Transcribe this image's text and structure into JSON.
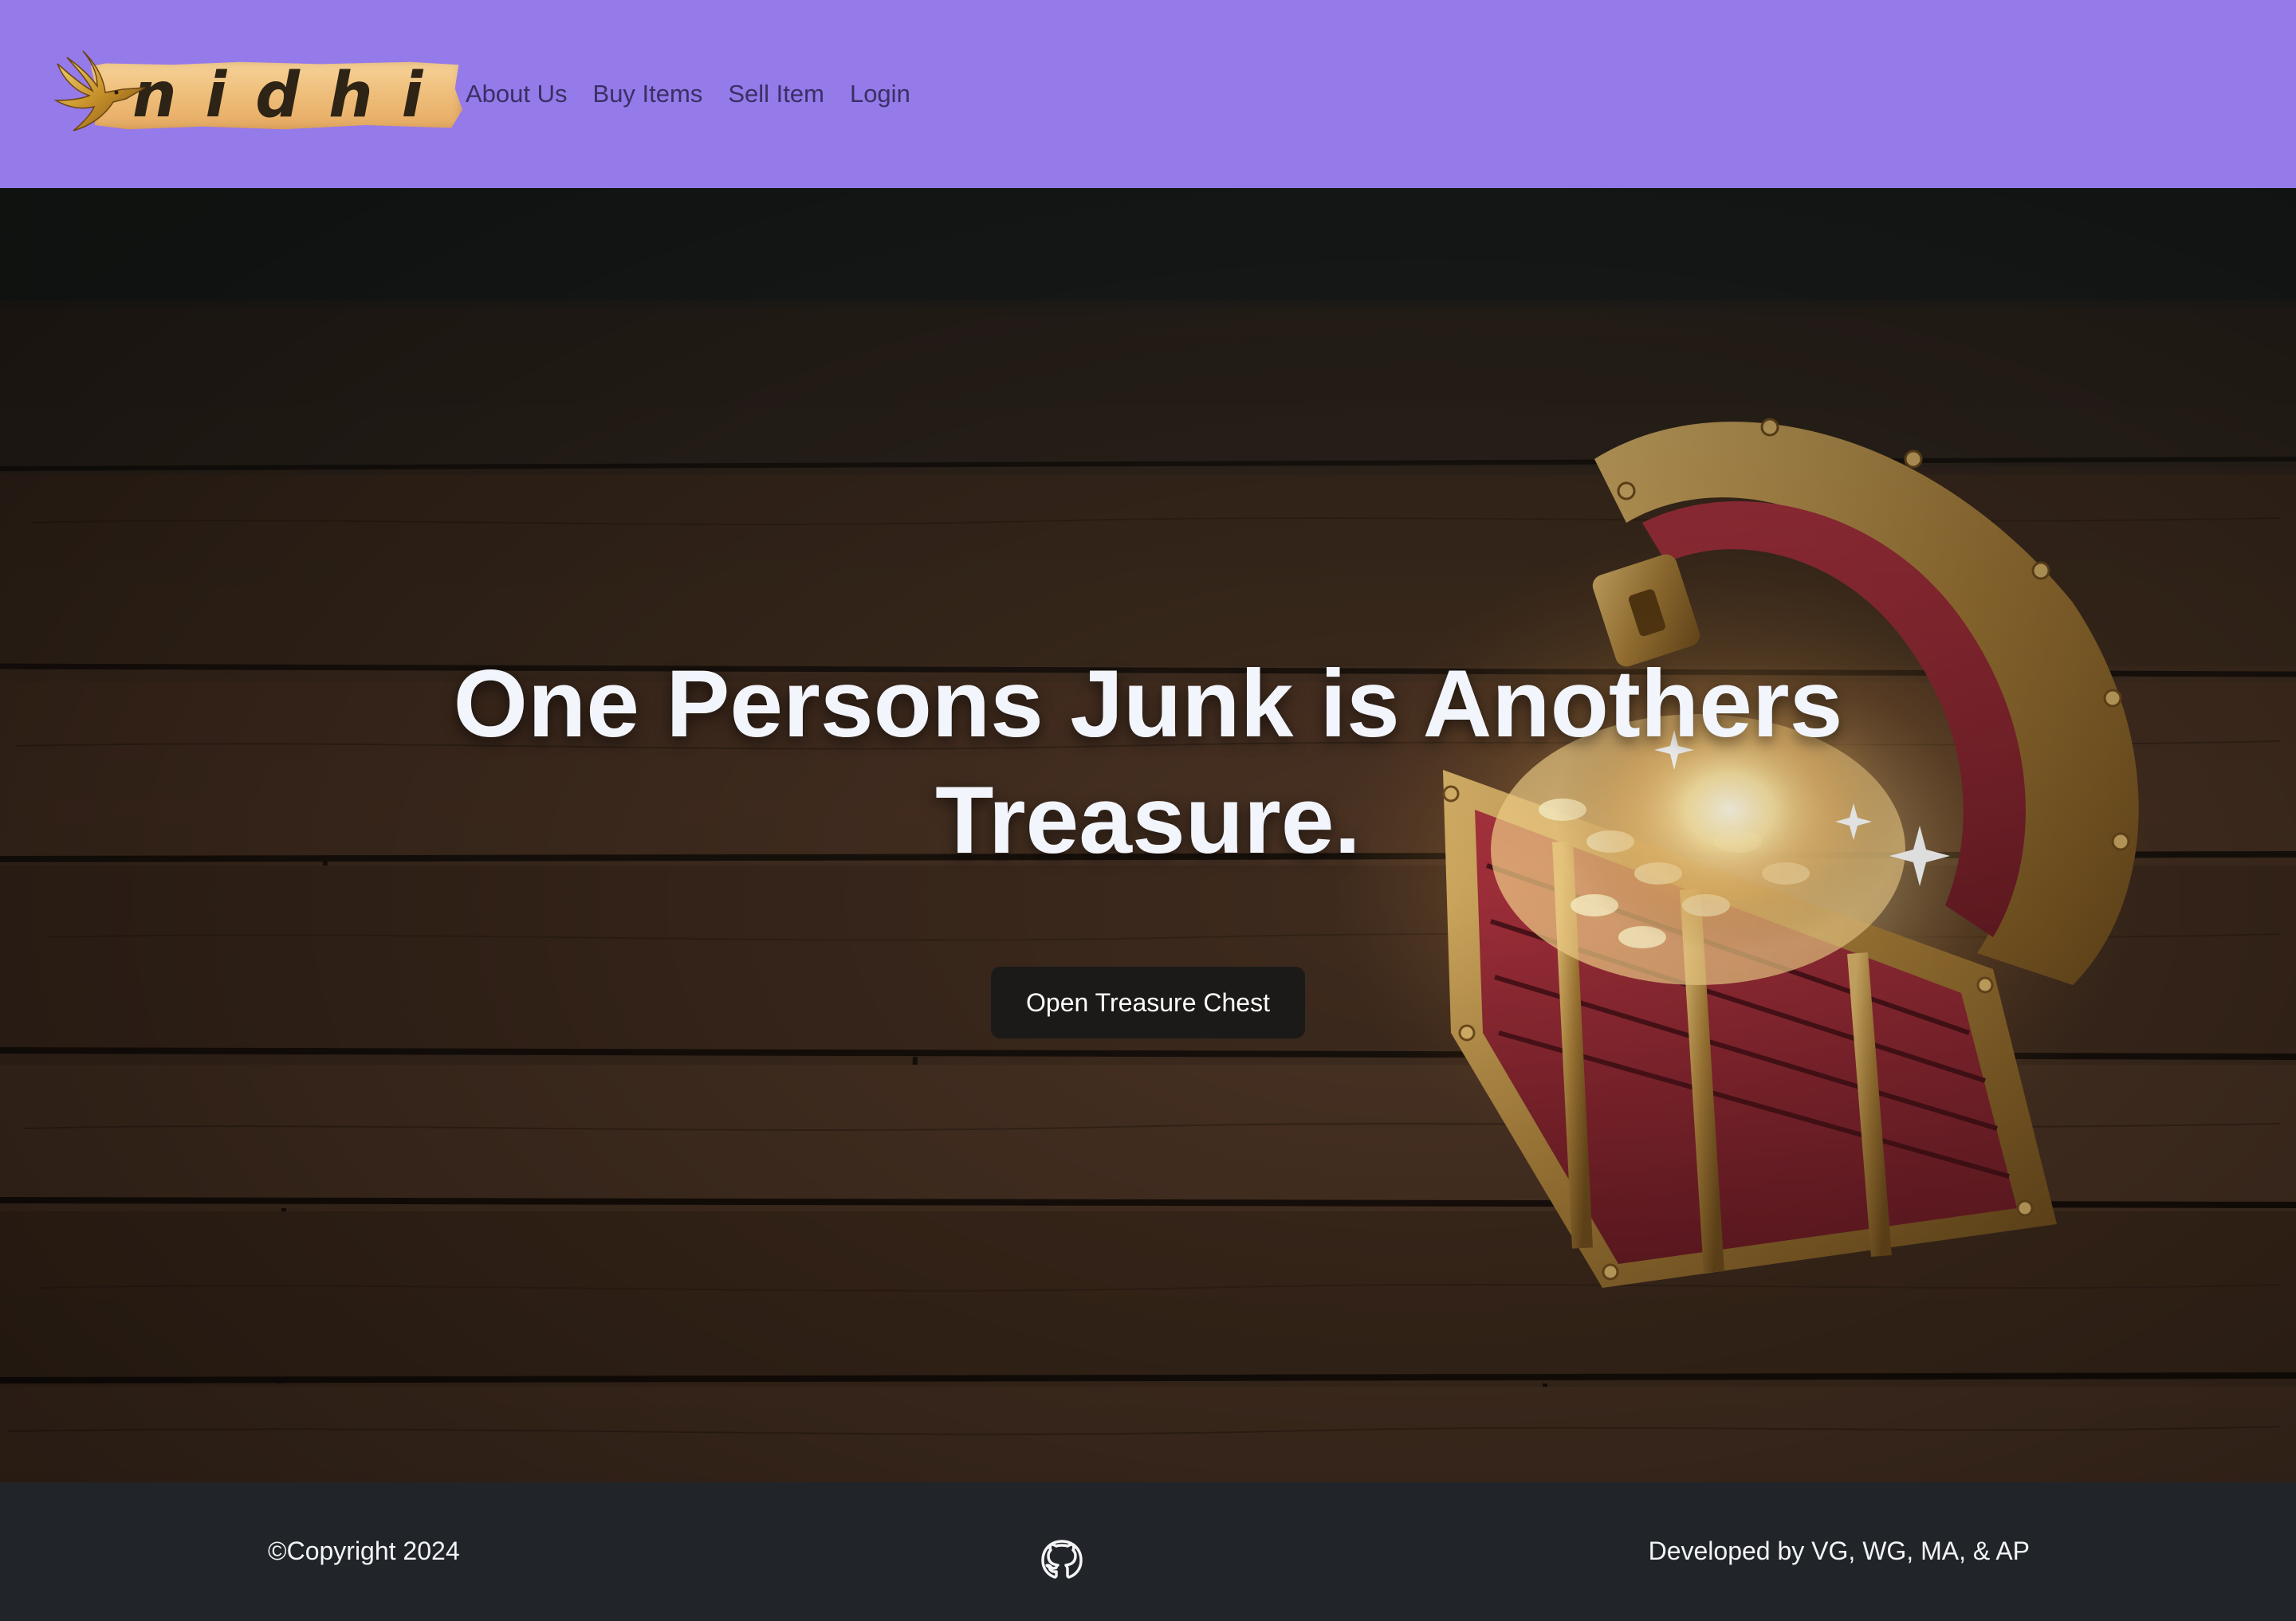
{
  "brand": {
    "name": "nidhi",
    "logo_icon": "golden-bird-icon"
  },
  "nav": {
    "links": [
      {
        "label": "About Us"
      },
      {
        "label": "Buy Items"
      },
      {
        "label": "Sell Item"
      },
      {
        "label": "Login"
      }
    ]
  },
  "hero": {
    "headline": "One Persons Junk is Anothers Treasure.",
    "cta_label": "Open Treasure Chest",
    "background": "treasure-chest-on-wood-photo"
  },
  "footer": {
    "copyright": "©Copyright 2024",
    "developed_by": "Developed by VG, WG, MA, & AP",
    "github_icon": "github-icon"
  },
  "colors": {
    "navbar_bg": "#957aea",
    "nav_link": "#3b2f63",
    "cta_bg": "#1b1a19",
    "footer_bg": "#212529",
    "headline": "#f2f5fb"
  }
}
